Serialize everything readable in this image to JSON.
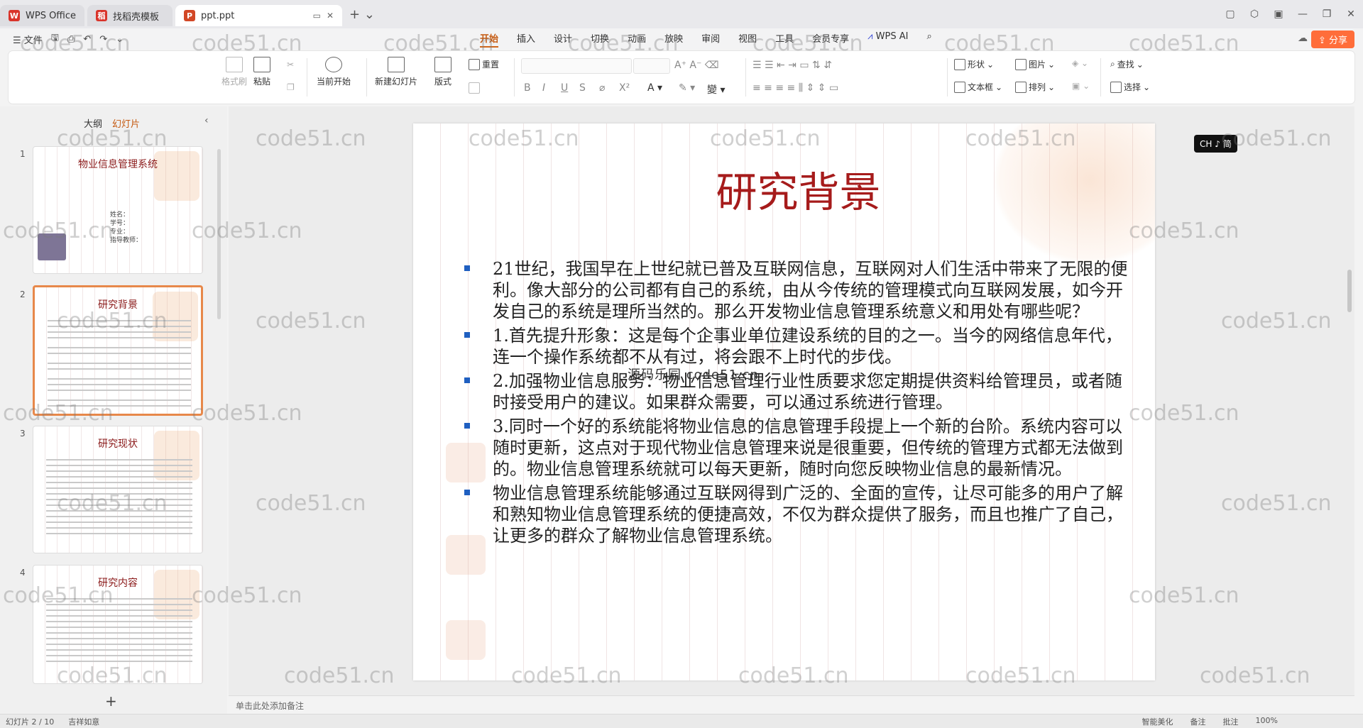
{
  "tabs": [
    {
      "label": "WPS Office",
      "color": "#d9342b",
      "glyph": "W"
    },
    {
      "label": "找稻壳模板",
      "color": "#d9342b",
      "glyph": "稻"
    },
    {
      "label": "ppt.ppt",
      "color": "#d24726",
      "glyph": "P"
    }
  ],
  "menu": {
    "file": "文件",
    "tabs": [
      "开始",
      "插入",
      "设计",
      "切换",
      "动画",
      "放映",
      "审阅",
      "视图",
      "工具",
      "会员专享"
    ],
    "active_tab": "开始",
    "ai": "WPS AI",
    "share": "分享"
  },
  "ribbon": {
    "format_painter": "格式刷",
    "paste": "粘贴",
    "play_from_current": "当前开始",
    "new_slide": "新建幻灯片",
    "layout": "版式",
    "reset": "重置",
    "shapes": "形状",
    "picture": "图片",
    "textbox": "文本框",
    "arrange": "排列",
    "find": "查找",
    "select": "选择"
  },
  "panel": {
    "tab_outline": "大纲",
    "tab_slides": "幻灯片",
    "thumbnails": [
      {
        "num": "1",
        "title": "物业信息管理系统",
        "info": [
          "姓名：",
          "学号：",
          "专业：",
          "指导教师："
        ]
      },
      {
        "num": "2",
        "title": "研究背景"
      },
      {
        "num": "3",
        "title": "研究现状"
      },
      {
        "num": "4",
        "title": "研究内容"
      }
    ]
  },
  "slide": {
    "title": "研究背景",
    "bullets": [
      "21世纪，我国早在上世纪就已普及互联网信息，互联网对人们生活中带来了无限的便利。像大部分的公司都有自己的系统，由从今传统的管理模式向互联网发展，如今开发自己的系统是理所当然的。那么开发物业信息管理系统意义和用处有哪些呢？",
      "1.首先提升形象：这是每个企事业单位建设系统的目的之一。当今的网络信息年代，连一个操作系统都不从有过，将会跟不上时代的步伐。",
      "2.加强物业信息服务：物业信息管理行业性质要求您定期提供资料给管理员，或者随时接受用户的建议。如果群众需要，可以通过系统进行管理。",
      "3.同时一个好的系统能将物业信息的信息管理手段提上一个新的台阶。系统内容可以随时更新，这点对于现代物业信息管理来说是很重要，但传统的管理方式都无法做到的。物业信息管理系统就可以每天更新，随时向您反映物业信息的最新情况。",
      "物业信息管理系统能够通过互联网得到广泛的、全面的宣传，让尽可能多的用户了解和熟知物业信息管理系统的便捷高效，不仅为群众提供了服务，而且也推广了自己，让更多的群众了解物业信息管理系统。"
    ],
    "overlay_text": "源码乐园 code51.cn"
  },
  "notes_placeholder": "单击此处添加备注",
  "ime": "CH ♪ 简",
  "status": {
    "left": [
      "幻灯片 2 / 10",
      "吉祥如意"
    ],
    "right": [
      "智能美化",
      "备注",
      "批注",
      "100%"
    ]
  },
  "watermark": "code51.cn"
}
